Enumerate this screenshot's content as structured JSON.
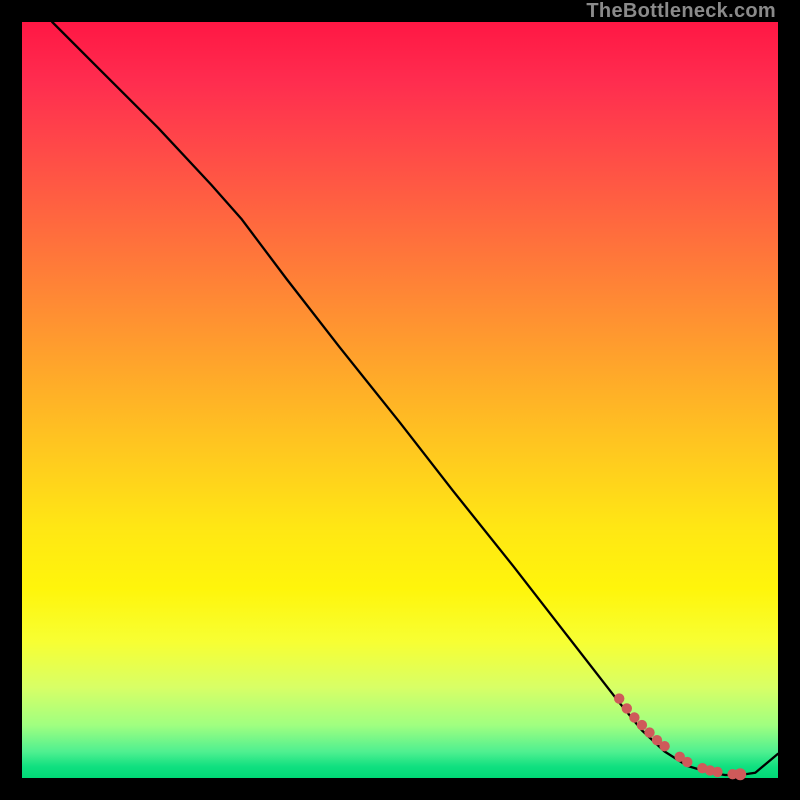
{
  "watermark": "TheBottleneck.com",
  "chart_data": {
    "type": "line",
    "title": "",
    "xlabel": "",
    "ylabel": "",
    "xlim": [
      0,
      100
    ],
    "ylim": [
      0,
      100
    ],
    "series": [
      {
        "name": "curve",
        "x": [
          4,
          10,
          18,
          25,
          29,
          35,
          42,
          50,
          57,
          65,
          72,
          79,
          82,
          85,
          88,
          91,
          93,
          95,
          97,
          100
        ],
        "values": [
          100,
          94,
          86,
          78.5,
          74,
          66,
          57,
          47,
          38,
          28,
          19,
          10,
          6.3,
          3.5,
          1.6,
          0.7,
          0.4,
          0.4,
          0.7,
          3.2
        ]
      }
    ],
    "markers": {
      "name": "bottom-cluster",
      "color": "#cf5a5a",
      "x": [
        79,
        80,
        81,
        82,
        83,
        84,
        85,
        87,
        88,
        90,
        91,
        92,
        94,
        95
      ],
      "values": [
        10.5,
        9.2,
        8.0,
        7.0,
        6.0,
        5.0,
        4.2,
        2.8,
        2.1,
        1.3,
        1.0,
        0.8,
        0.5,
        0.5
      ]
    }
  },
  "colors": {
    "line": "#000000",
    "marker": "#cf5a5a",
    "background_top": "#ff1744",
    "background_bottom": "#00d876"
  }
}
